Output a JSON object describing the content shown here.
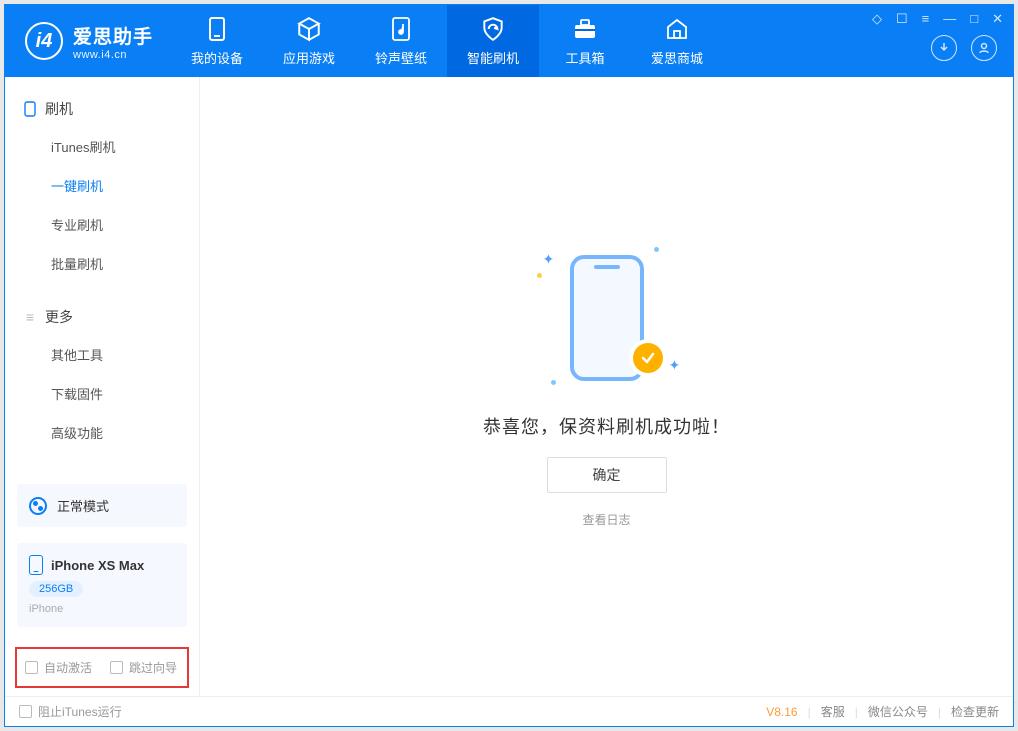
{
  "brand": {
    "title": "爱思助手",
    "subtitle": "www.i4.cn"
  },
  "tabs": {
    "device": "我的设备",
    "apps": "应用游戏",
    "ringtone": "铃声壁纸",
    "flash": "智能刷机",
    "toolbox": "工具箱",
    "store": "爱思商城"
  },
  "sidebar": {
    "group_flash": "刷机",
    "items_flash": {
      "itunes": "iTunes刷机",
      "oneclick": "一键刷机",
      "pro": "专业刷机",
      "batch": "批量刷机"
    },
    "group_more": "更多",
    "items_more": {
      "other": "其他工具",
      "firmware": "下载固件",
      "advanced": "高级功能"
    }
  },
  "mode": {
    "label": "正常模式"
  },
  "device": {
    "name": "iPhone XS Max",
    "capacity": "256GB",
    "type": "iPhone"
  },
  "options": {
    "auto_activate": "自动激活",
    "skip_wizard": "跳过向导"
  },
  "main": {
    "success": "恭喜您，保资料刷机成功啦！",
    "ok": "确定",
    "view_log": "查看日志"
  },
  "footer": {
    "block_itunes": "阻止iTunes运行",
    "version": "V8.16",
    "support": "客服",
    "wechat": "微信公众号",
    "update": "检查更新"
  }
}
